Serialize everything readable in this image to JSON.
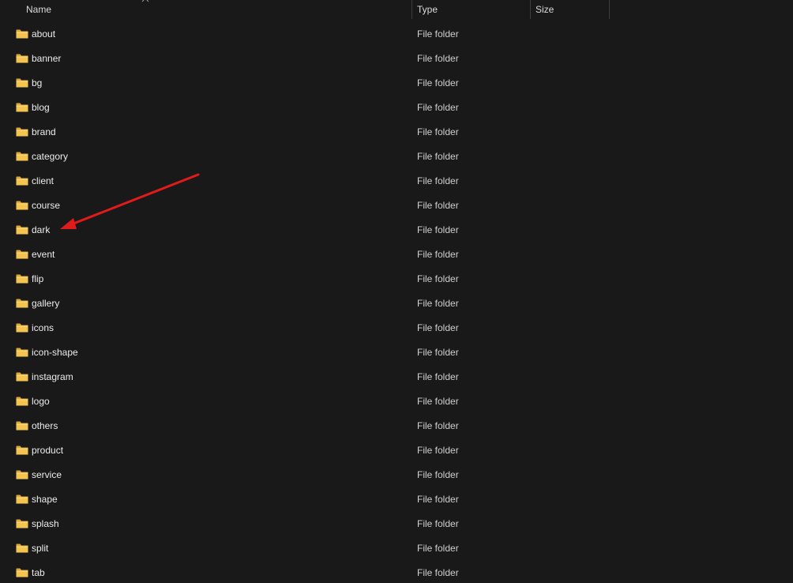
{
  "header": {
    "name_label": "Name",
    "type_label": "Type",
    "size_label": "Size",
    "sort_icon": "chevron-up-icon"
  },
  "files": [
    {
      "name": "about",
      "type": "File folder",
      "size": ""
    },
    {
      "name": "banner",
      "type": "File folder",
      "size": ""
    },
    {
      "name": "bg",
      "type": "File folder",
      "size": ""
    },
    {
      "name": "blog",
      "type": "File folder",
      "size": ""
    },
    {
      "name": "brand",
      "type": "File folder",
      "size": ""
    },
    {
      "name": "category",
      "type": "File folder",
      "size": ""
    },
    {
      "name": "client",
      "type": "File folder",
      "size": ""
    },
    {
      "name": "course",
      "type": "File folder",
      "size": ""
    },
    {
      "name": "dark",
      "type": "File folder",
      "size": ""
    },
    {
      "name": "event",
      "type": "File folder",
      "size": ""
    },
    {
      "name": "flip",
      "type": "File folder",
      "size": ""
    },
    {
      "name": "gallery",
      "type": "File folder",
      "size": ""
    },
    {
      "name": "icons",
      "type": "File folder",
      "size": ""
    },
    {
      "name": "icon-shape",
      "type": "File folder",
      "size": ""
    },
    {
      "name": "instagram",
      "type": "File folder",
      "size": ""
    },
    {
      "name": "logo",
      "type": "File folder",
      "size": ""
    },
    {
      "name": "others",
      "type": "File folder",
      "size": ""
    },
    {
      "name": "product",
      "type": "File folder",
      "size": ""
    },
    {
      "name": "service",
      "type": "File folder",
      "size": ""
    },
    {
      "name": "shape",
      "type": "File folder",
      "size": ""
    },
    {
      "name": "splash",
      "type": "File folder",
      "size": ""
    },
    {
      "name": "split",
      "type": "File folder",
      "size": ""
    },
    {
      "name": "tab",
      "type": "File folder",
      "size": ""
    }
  ],
  "annotation": {
    "kind": "arrow",
    "color": "#e01b1b",
    "points_to": "dark"
  },
  "colors": {
    "background": "#191919",
    "folder": "#f3c44f",
    "folder_shade": "#dca83a",
    "text": "#ececec"
  }
}
